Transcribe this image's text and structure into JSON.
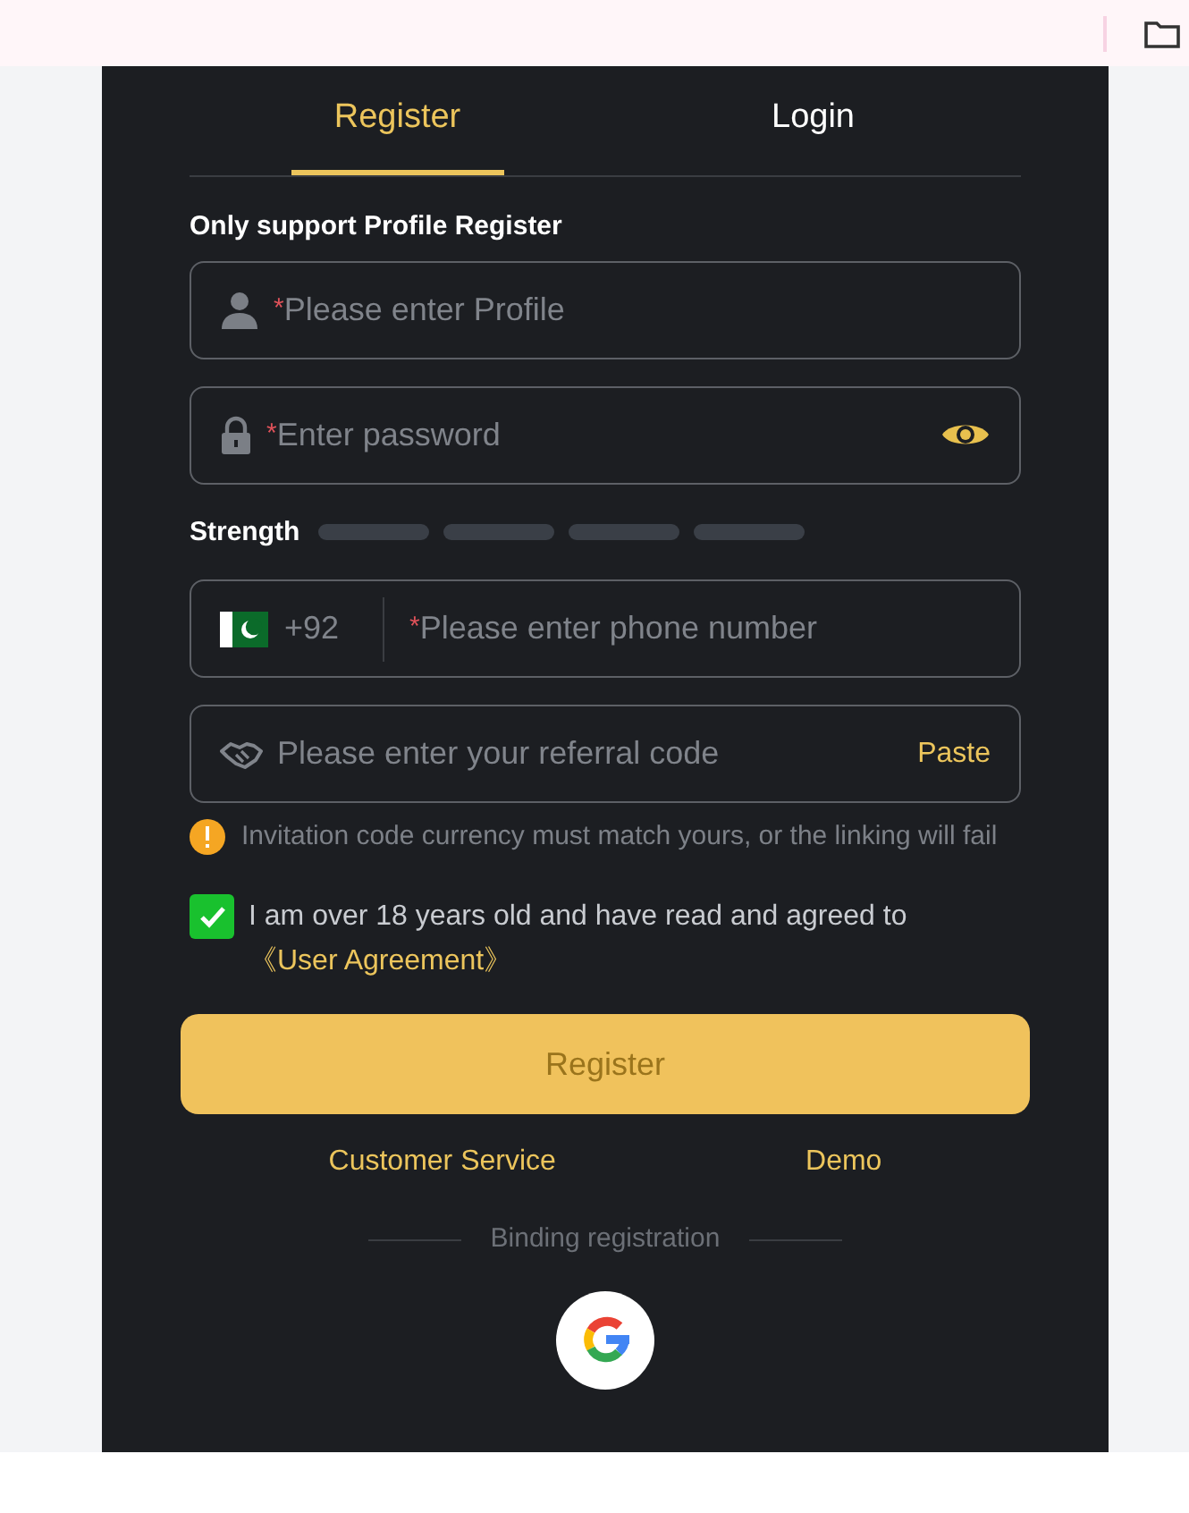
{
  "tabs": [
    {
      "label": "Register",
      "selected": true
    },
    {
      "label": "Login",
      "selected": false
    }
  ],
  "section_label": "Only support Profile Register",
  "fields": [
    {
      "kind": "profile",
      "required_mark": "*",
      "placeholder": "Please enter Profile"
    },
    {
      "kind": "password",
      "required_mark": "*",
      "placeholder": "Enter password"
    }
  ],
  "strength": {
    "label": "Strength"
  },
  "phone": {
    "code": "+92",
    "required_mark": "*",
    "placeholder": "Please enter phone number"
  },
  "referral": {
    "placeholder": "Please enter your referral code",
    "action": "Paste",
    "notice": "Invitation code currency must match yours, or the linking will fail"
  },
  "agreement": {
    "checked": true,
    "text": "I am over 18 years old and have read and agreed to ",
    "link": "《User Agreement》"
  },
  "submit": "Register",
  "links": [
    "Customer Service",
    "Demo"
  ],
  "binding_label": "Binding registration"
}
